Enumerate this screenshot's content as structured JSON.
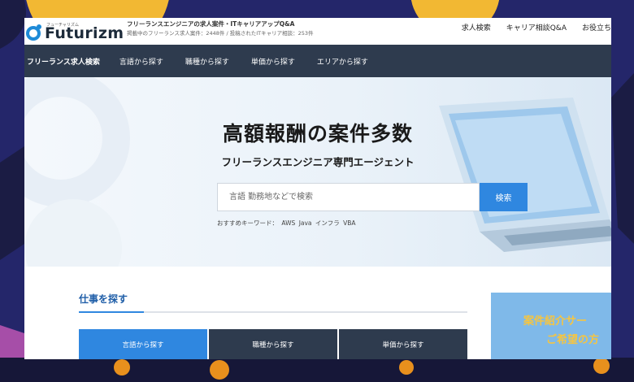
{
  "header": {
    "logo_text": "Futurizm",
    "logo_kana": "フューチャリズム",
    "tagline": "フリーランスエンジニアの求人案件・ITキャリアアップQ&A",
    "stats": "掲載中のフリーランス求人案件：2448件 / 投稿されたITキャリア相談：253件",
    "nav": [
      "求人検索",
      "キャリア相談Q&A",
      "お役立ち"
    ]
  },
  "category_nav": {
    "items": [
      "フリーランス求人検索",
      "言語から探す",
      "職種から探す",
      "単価から探す",
      "エリアから探す"
    ]
  },
  "hero": {
    "title": "高額報酬の案件多数",
    "subtitle": "フリーランスエンジニア専門エージェント",
    "search_placeholder": "言語 勤務地などで検索",
    "search_button": "検索",
    "keywords_label": "おすすめキーワード：",
    "keywords": [
      "AWS",
      "Java",
      "インフラ",
      "VBA"
    ]
  },
  "main": {
    "section_title": "仕事を探す",
    "tabs": [
      "言語から探す",
      "職種から探す",
      "単価から探す"
    ]
  },
  "banner": {
    "line1": "案件紹介サー",
    "line2": "ご希望の方"
  },
  "colors": {
    "accent": "#2f87e0",
    "nav_bg": "#2e3b4e",
    "backdrop": "#22245c",
    "banner_text": "#f5c542"
  }
}
